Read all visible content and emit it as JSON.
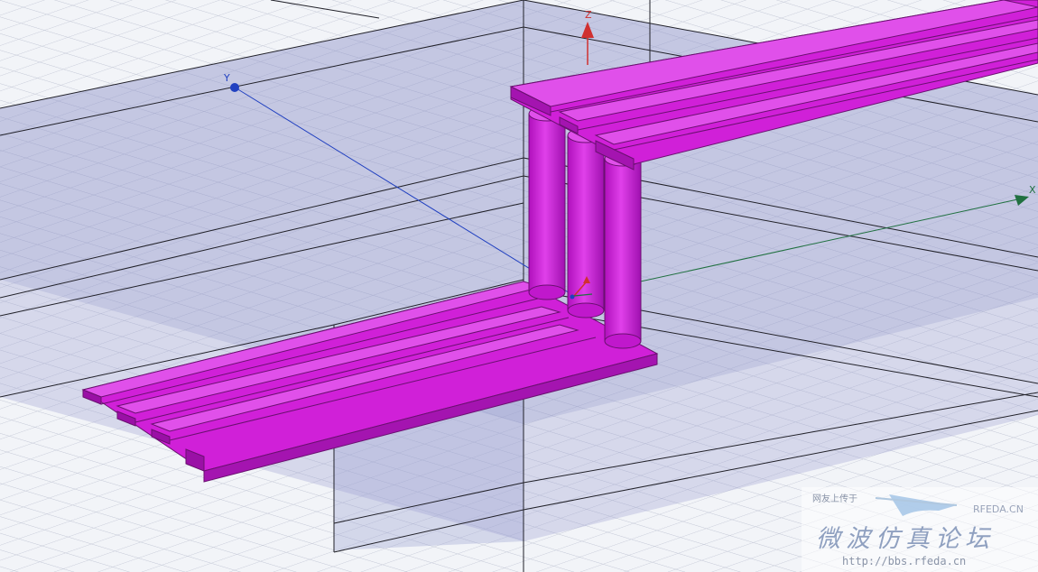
{
  "colors": {
    "background": "#f2f4f8",
    "grid_line": "#c3c8d6",
    "substrate_fill": "#9aa0d0",
    "trace": "#d020d8",
    "trace_edge": "#6a1070",
    "axis_z": "#d03030",
    "axis_y": "#2040c0",
    "axis_x": "#207040",
    "edge": "#202028"
  },
  "axes": {
    "z": {
      "label": "Z",
      "icon": "arrow-up"
    },
    "y": {
      "label": "Y",
      "icon": "arrow-diagonal"
    },
    "x": {
      "label": "X",
      "icon": "arrow-right"
    }
  },
  "watermark": {
    "line1": "网友上传于",
    "brand": "RFEDA.CN",
    "title": "微波仿真论坛",
    "url": "http://bbs.rfeda.cn"
  }
}
